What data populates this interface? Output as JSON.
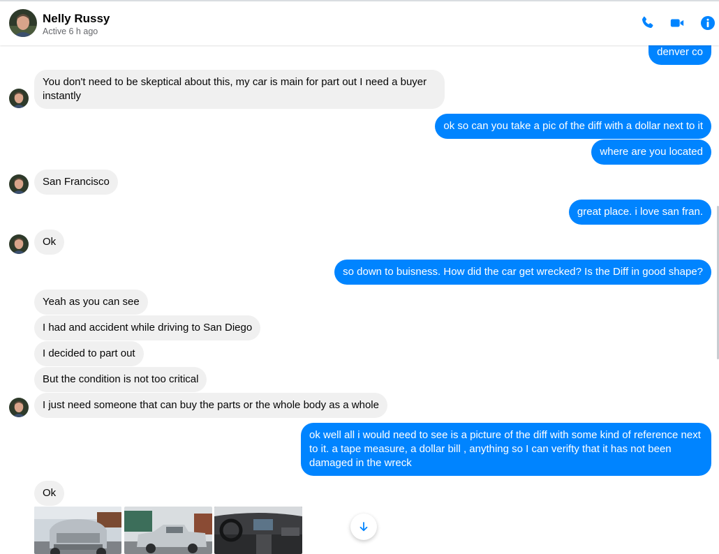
{
  "header": {
    "contact_name": "Nelly Russy",
    "status": "Active 6 h ago",
    "actions": [
      {
        "icon": "phone-icon",
        "label": "Start a voice call"
      },
      {
        "icon": "video-camera-icon",
        "label": "Start a video chat"
      },
      {
        "icon": "info-icon",
        "label": "Conversation information"
      }
    ]
  },
  "messages": {
    "m1": "denver co",
    "m2": "You don't need to be skeptical about this, my car is main for part out I need a buyer instantly",
    "m3": "ok so can you take a pic of the diff with a dollar next to it",
    "m4": "where are you located",
    "m5": "San Francisco",
    "m6": "great place. i love san fran.",
    "m7": "Ok",
    "m8": "so down to buisness. How did the car get wrecked? Is the Diff in good shape?",
    "m9": "Yeah as you can see",
    "m10": "I had and accident while driving to San Diego",
    "m11": "I decided to part out",
    "m12": "But the condition is not too critical",
    "m13": "I just need someone that can buy the parts or the whole body as a whole",
    "m14": "ok well all i would need to see is a picture of the diff with some kind of reference next to it. a tape measure, a dollar bill , anything so I can verifty that it has not been damaged in the wreck",
    "m15": "Ok"
  },
  "attachments": [
    {
      "kind": "photo",
      "subject": "silver pickup truck front, damaged"
    },
    {
      "kind": "photo",
      "subject": "silver pickup truck side, damaged"
    },
    {
      "kind": "photo",
      "subject": "truck interior dashboard"
    }
  ],
  "colors": {
    "accent": "#0084ff",
    "incoming_bubble": "#f0f0f0",
    "secondary_text": "#65676b"
  }
}
